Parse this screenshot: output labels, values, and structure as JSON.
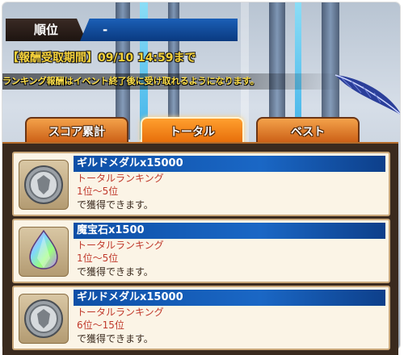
{
  "rank": {
    "label": "順位",
    "value": "-"
  },
  "period_text": "【報酬受取期間】09/10 14:59まで",
  "notice": "ランキング報酬はイベント終了後に受け取れるようになります。",
  "tabs": [
    {
      "label": "スコア累計",
      "active": false
    },
    {
      "label": "トータル",
      "active": true
    },
    {
      "label": "ベスト",
      "active": false
    }
  ],
  "rewards": [
    {
      "icon": "guild-medal-icon",
      "title": "ギルドメダルx15000",
      "ranking": "トータルランキング",
      "range": "1位〜5位",
      "note": "で獲得できます。"
    },
    {
      "icon": "magic-gem-icon",
      "title": "魔宝石x1500",
      "ranking": "トータルランキング",
      "range": "1位〜5位",
      "note": "で獲得できます。"
    },
    {
      "icon": "guild-medal-icon",
      "title": "ギルドメダルx15000",
      "ranking": "トータルランキング",
      "range": "6位〜15位",
      "note": "で獲得できます。"
    }
  ]
}
